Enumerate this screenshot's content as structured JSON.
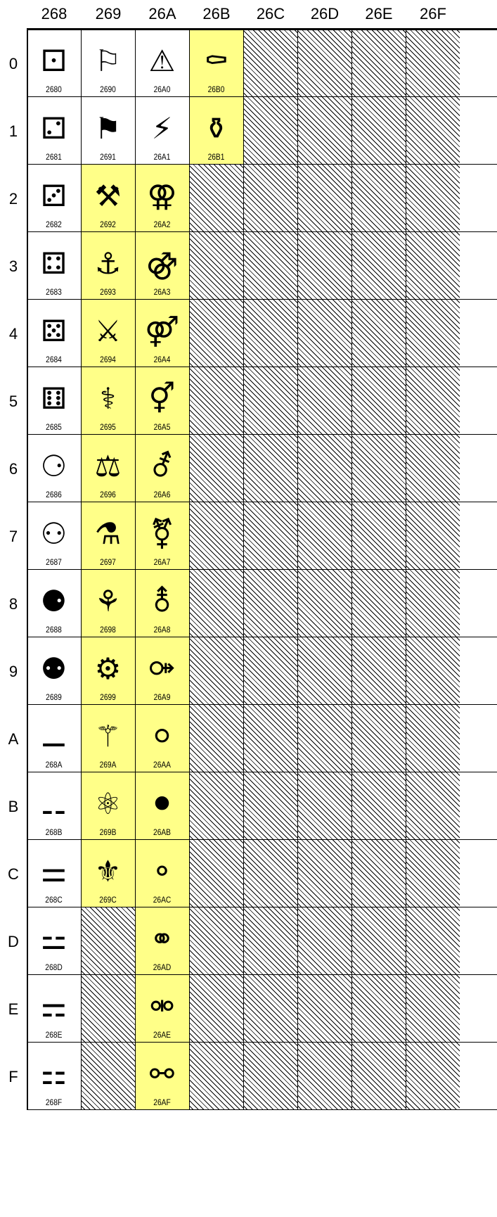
{
  "columns": [
    "268",
    "269",
    "26A",
    "26B",
    "26C",
    "26D",
    "26E",
    "26F"
  ],
  "rows": [
    "0",
    "1",
    "2",
    "3",
    "4",
    "5",
    "6",
    "7",
    "8",
    "9",
    "A",
    "B",
    "C",
    "D",
    "E",
    "F"
  ],
  "highlight_color": "#ffff88",
  "cells": [
    [
      {
        "code": "2680",
        "glyph": "⚀",
        "hl": false
      },
      {
        "code": "2681",
        "glyph": "⚁",
        "hl": false
      },
      {
        "code": "2682",
        "glyph": "⚂",
        "hl": false
      },
      {
        "code": "2683",
        "glyph": "⚃",
        "hl": false
      },
      {
        "code": "2684",
        "glyph": "⚄",
        "hl": false
      },
      {
        "code": "2685",
        "glyph": "⚅",
        "hl": false
      },
      {
        "code": "2686",
        "glyph": "⚆",
        "hl": false
      },
      {
        "code": "2687",
        "glyph": "⚇",
        "hl": false
      },
      {
        "code": "2688",
        "glyph": "⚈",
        "hl": false
      },
      {
        "code": "2689",
        "glyph": "⚉",
        "hl": false
      },
      {
        "code": "268A",
        "glyph": "⚊",
        "hl": false
      },
      {
        "code": "268B",
        "glyph": "⚋",
        "hl": false
      },
      {
        "code": "268C",
        "glyph": "⚌",
        "hl": false
      },
      {
        "code": "268D",
        "glyph": "⚍",
        "hl": false
      },
      {
        "code": "268E",
        "glyph": "⚎",
        "hl": false
      },
      {
        "code": "268F",
        "glyph": "⚏",
        "hl": false
      }
    ],
    [
      {
        "code": "2690",
        "glyph": "⚐",
        "hl": false
      },
      {
        "code": "2691",
        "glyph": "⚑",
        "hl": false
      },
      {
        "code": "2692",
        "glyph": "⚒",
        "hl": true
      },
      {
        "code": "2693",
        "glyph": "⚓",
        "hl": true
      },
      {
        "code": "2694",
        "glyph": "⚔",
        "hl": true
      },
      {
        "code": "2695",
        "glyph": "⚕",
        "hl": true
      },
      {
        "code": "2696",
        "glyph": "⚖",
        "hl": true
      },
      {
        "code": "2697",
        "glyph": "⚗",
        "hl": true
      },
      {
        "code": "2698",
        "glyph": "⚘",
        "hl": true
      },
      {
        "code": "2699",
        "glyph": "⚙",
        "hl": true
      },
      {
        "code": "269A",
        "glyph": "⚚",
        "hl": true
      },
      {
        "code": "269B",
        "glyph": "⚛",
        "hl": true
      },
      {
        "code": "269C",
        "glyph": "⚜",
        "hl": true
      },
      null,
      null,
      null
    ],
    [
      {
        "code": "26A0",
        "glyph": "⚠",
        "hl": false
      },
      {
        "code": "26A1",
        "glyph": "⚡",
        "hl": false
      },
      {
        "code": "26A2",
        "glyph": "⚢",
        "hl": true
      },
      {
        "code": "26A3",
        "glyph": "⚣",
        "hl": true
      },
      {
        "code": "26A4",
        "glyph": "⚤",
        "hl": true
      },
      {
        "code": "26A5",
        "glyph": "⚥",
        "hl": true
      },
      {
        "code": "26A6",
        "glyph": "⚦",
        "hl": true
      },
      {
        "code": "26A7",
        "glyph": "⚧",
        "hl": true
      },
      {
        "code": "26A8",
        "glyph": "⚨",
        "hl": true
      },
      {
        "code": "26A9",
        "glyph": "⚩",
        "hl": true
      },
      {
        "code": "26AA",
        "glyph": "⚪",
        "hl": true
      },
      {
        "code": "26AB",
        "glyph": "⚫",
        "hl": true
      },
      {
        "code": "26AC",
        "glyph": "⚬",
        "hl": true
      },
      {
        "code": "26AD",
        "glyph": "⚭",
        "hl": true
      },
      {
        "code": "26AE",
        "glyph": "⚮",
        "hl": true
      },
      {
        "code": "26AF",
        "glyph": "⚯",
        "hl": true
      }
    ],
    [
      {
        "code": "26B0",
        "glyph": "⚰",
        "hl": true
      },
      {
        "code": "26B1",
        "glyph": "⚱",
        "hl": true
      },
      null,
      null,
      null,
      null,
      null,
      null,
      null,
      null,
      null,
      null,
      null,
      null,
      null,
      null
    ],
    [
      null,
      null,
      null,
      null,
      null,
      null,
      null,
      null,
      null,
      null,
      null,
      null,
      null,
      null,
      null,
      null
    ],
    [
      null,
      null,
      null,
      null,
      null,
      null,
      null,
      null,
      null,
      null,
      null,
      null,
      null,
      null,
      null,
      null
    ],
    [
      null,
      null,
      null,
      null,
      null,
      null,
      null,
      null,
      null,
      null,
      null,
      null,
      null,
      null,
      null,
      null
    ],
    [
      null,
      null,
      null,
      null,
      null,
      null,
      null,
      null,
      null,
      null,
      null,
      null,
      null,
      null,
      null,
      null
    ]
  ]
}
